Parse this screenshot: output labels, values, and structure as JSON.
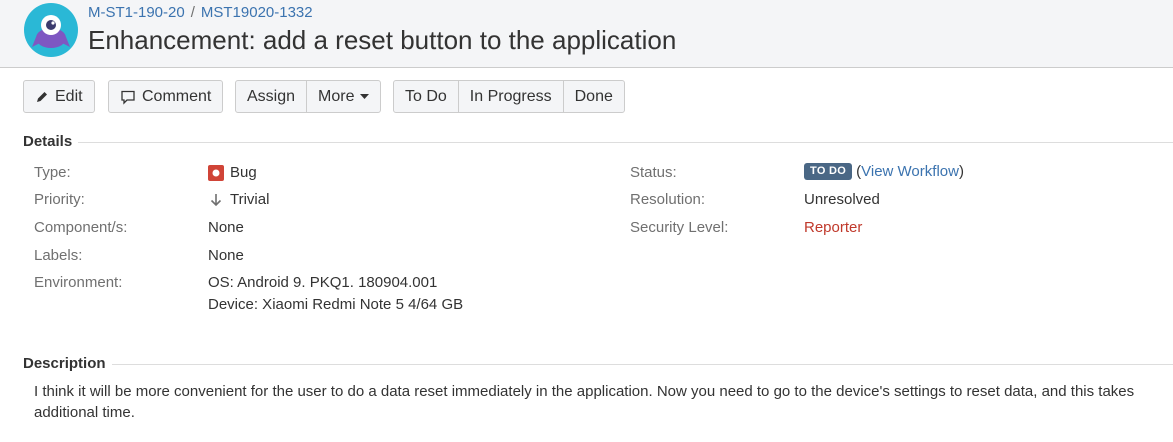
{
  "header": {
    "breadcrumb": {
      "project": "M-ST1-190-20",
      "separator": "/",
      "issue_key": "MST19020-1332"
    },
    "title": "Enhancement: add a reset button to the application"
  },
  "toolbar": {
    "edit": "Edit",
    "comment": "Comment",
    "assign": "Assign",
    "more": "More",
    "todo": "To Do",
    "in_progress": "In Progress",
    "done": "Done"
  },
  "details": {
    "heading": "Details",
    "type_label": "Type:",
    "type_value": "Bug",
    "priority_label": "Priority:",
    "priority_value": "Trivial",
    "components_label": "Component/s:",
    "components_value": "None",
    "labels_label": "Labels:",
    "labels_value": "None",
    "environment_label": "Environment:",
    "environment_line1": "OS: Android 9. PKQ1. 180904.001",
    "environment_line2": "Device: Xiaomi Redmi Note 5 4/64 GB",
    "status_label": "Status:",
    "status_value": "TO DO",
    "workflow_open": "(",
    "workflow_link": "View Workflow",
    "workflow_close": ")",
    "resolution_label": "Resolution:",
    "resolution_value": "Unresolved",
    "security_label": "Security Level:",
    "security_value": "Reporter"
  },
  "description": {
    "heading": "Description",
    "text": "I think it will be more convenient for the user to do a data reset immediately in the application. Now you need to go to the device's settings to reset data, and this takes additional time."
  },
  "colors": {
    "link": "#3b73af",
    "bug": "#d04437",
    "status_lozenge": "#4a6785",
    "security": "#c0392b"
  }
}
